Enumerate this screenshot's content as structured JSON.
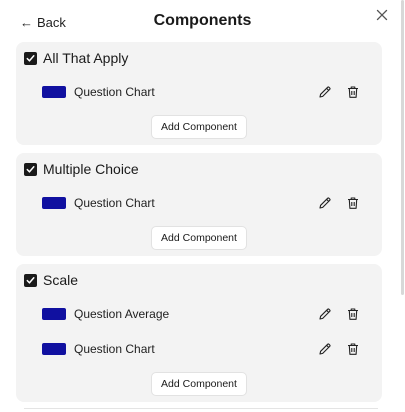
{
  "header": {
    "back_label": "Back",
    "title": "Components",
    "close_icon": "close-icon"
  },
  "colors": {
    "swatch": "#1010a0",
    "group_bg": "#f3f3f3",
    "checkbox": "#1a1a1a"
  },
  "groups": [
    {
      "title": "All That Apply",
      "checked": true,
      "components": [
        {
          "label": "Question Chart"
        }
      ],
      "add_label": "Add Component"
    },
    {
      "title": "Multiple Choice",
      "checked": true,
      "components": [
        {
          "label": "Question Chart"
        }
      ],
      "add_label": "Add Component"
    },
    {
      "title": "Scale",
      "checked": true,
      "components": [
        {
          "label": "Question Average"
        },
        {
          "label": "Question Chart"
        }
      ],
      "add_label": "Add Component"
    }
  ]
}
